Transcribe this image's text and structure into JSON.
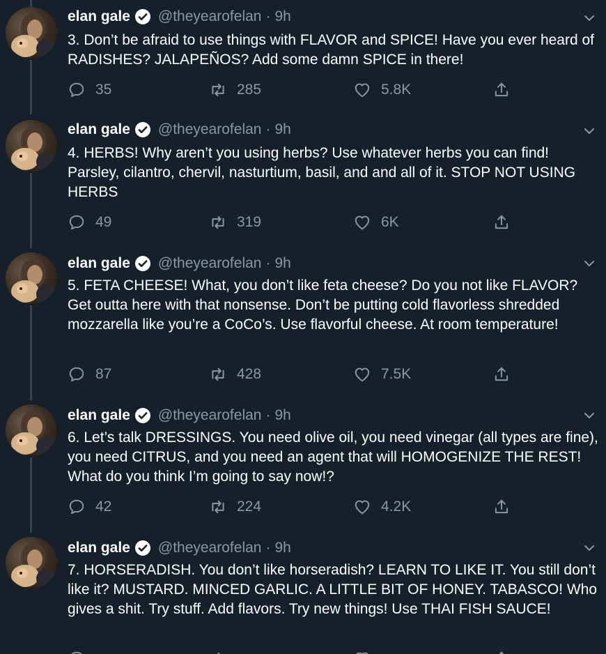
{
  "tweets": [
    {
      "name": "elan gale",
      "handle": "@theyearofelan",
      "time": "9h",
      "text": "3. Don’t be afraid to use things with FLAVOR and SPICE! Have you ever heard of RADISHES? JALAPEÑOS? Add some damn SPICE in there!",
      "replies": "35",
      "retweets": "285",
      "likes": "5.8K"
    },
    {
      "name": "elan gale",
      "handle": "@theyearofelan",
      "time": "9h",
      "text": "4. HERBS! Why aren’t you using herbs? Use whatever herbs you can find! Parsley, cilantro, chervil, nasturtium, basil, and and all of it. STOP NOT USING HERBS",
      "replies": "49",
      "retweets": "319",
      "likes": "6K"
    },
    {
      "name": "elan gale",
      "handle": "@theyearofelan",
      "time": "9h",
      "text": "5. FETA CHEESE! What, you don’t like feta cheese? Do you not like FLAVOR? Get outta here with that nonsense. Don’t be putting cold flavorless shredded mozzarella like you’re a CoCo’s. Use flavorful cheese. At room temperature!",
      "replies": "87",
      "retweets": "428",
      "likes": "7.5K"
    },
    {
      "name": "elan gale",
      "handle": "@theyearofelan",
      "time": "9h",
      "text": "6. Let’s talk DRESSINGS. You need olive oil, you need vinegar (all types are fine), you need CITRUS, and you need an agent that will HOMOGENIZE THE REST! What do you think I’m going to say now!?",
      "replies": "42",
      "retweets": "224",
      "likes": "4.2K"
    },
    {
      "name": "elan gale",
      "handle": "@theyearofelan",
      "time": "9h",
      "text": "7. HORSERADISH. You don’t like horseradish? LEARN TO LIKE IT. You still don’t like it? MUSTARD. MINCED GARLIC. A LITTLE BIT OF HONEY. TABASCO! Who gives a shit. Try stuff. Add flavors. Try new things! Use THAI FISH SAUCE!",
      "replies": "",
      "retweets": "",
      "likes": ""
    }
  ],
  "separator": "·",
  "colors": {
    "background": "#15202b",
    "text": "#ffffff",
    "muted": "#8899a6",
    "thread_line": "#38444d"
  },
  "icons": {
    "verified": "verified-badge-icon",
    "caret": "chevron-down-icon",
    "reply": "reply-icon",
    "retweet": "retweet-icon",
    "like": "heart-icon",
    "share": "share-icon"
  }
}
